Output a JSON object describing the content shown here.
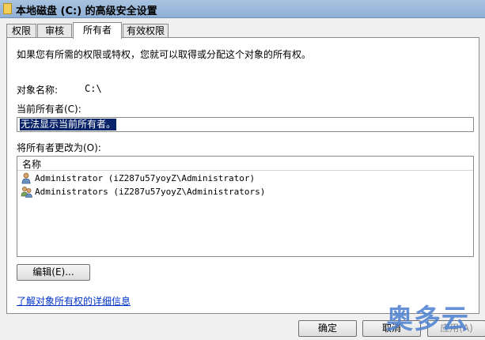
{
  "window": {
    "title": "本地磁盘 (C:) 的高级安全设置"
  },
  "tabs": [
    {
      "label": "权限",
      "active": false
    },
    {
      "label": "审核",
      "active": false
    },
    {
      "label": "所有者",
      "active": true
    },
    {
      "label": "有效权限",
      "active": false
    }
  ],
  "owner_tab": {
    "intro": "如果您有所需的权限或特权，您就可以取得或分配这个对象的所有权。",
    "object_name_label": "对象名称:",
    "object_name_value": "C:\\",
    "current_owner_label": "当前所有者(C):",
    "current_owner_value": "无法显示当前所有者。",
    "change_owner_label": "将所有者更改为(O):",
    "list_column_name": "名称",
    "list_rows": [
      {
        "text": "Administrator (iZ287u57yoyZ\\Administrator)",
        "icon": "user-icon"
      },
      {
        "text": "Administrators (iZ287u57yoyZ\\Administrators)",
        "icon": "group-icon"
      }
    ],
    "edit_button": "编辑(E)...",
    "learn_more_link": "了解对象所有权的详细信息"
  },
  "footer": {
    "ok": "确定",
    "cancel": "取消",
    "apply": "应用(A)"
  },
  "watermark": "奥多云",
  "colors": {
    "titlebar": "#8fb0d6",
    "selection": "#0a246a",
    "link": "#0033cc",
    "watermark": "#4b7fd1"
  }
}
